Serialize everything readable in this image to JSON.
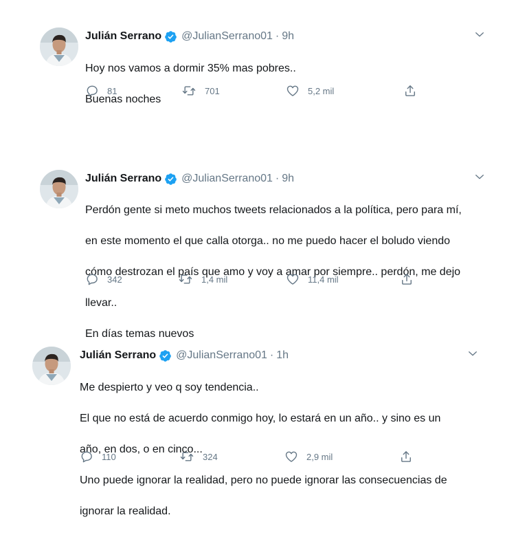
{
  "tweets": [
    {
      "name": "Julián Serrano",
      "handle": "@JulianSerrano01",
      "separator": "·",
      "time": "9h",
      "lines": [
        "Hoy nos vamos a dormir 35% mas pobres..",
        "Buenas noches"
      ],
      "replies": "81",
      "retweets": "701",
      "likes": "5,2 mil"
    },
    {
      "name": "Julián Serrano",
      "handle": "@JulianSerrano01",
      "separator": "·",
      "time": "9h",
      "lines": [
        "Perdón gente si meto muchos tweets relacionados a la política, pero para mí,",
        "en este momento el que calla otorga.. no me puedo hacer el boludo viendo",
        "cómo destrozan el país que amo y voy a amar por siempre.. perdón, me dejo",
        "llevar..",
        "En días temas nuevos"
      ],
      "replies": "342",
      "retweets": "1,4 mil",
      "likes": "11,4 mil"
    },
    {
      "name": "Julián Serrano",
      "handle": "@JulianSerrano01",
      "separator": "·",
      "time": "1h",
      "lines": [
        "Me despierto y veo q soy tendencia..",
        "El que no está de acuerdo conmigo hoy, lo estará en un año.. y sino es un",
        "año, en dos, o en cinco...",
        "Uno puede ignorar la realidad, pero no puede ignorar las consecuencias de",
        "ignorar la realidad."
      ],
      "replies": "110",
      "retweets": "324",
      "likes": "2,9 mil"
    }
  ],
  "icons": {
    "verified": "verified-badge-icon",
    "more": "chevron-down-icon",
    "reply": "reply-icon",
    "retweet": "retweet-icon",
    "like": "heart-icon",
    "share": "share-icon"
  },
  "colors": {
    "text": "#14171a",
    "secondary": "#657786",
    "verified": "#1da1f2"
  }
}
